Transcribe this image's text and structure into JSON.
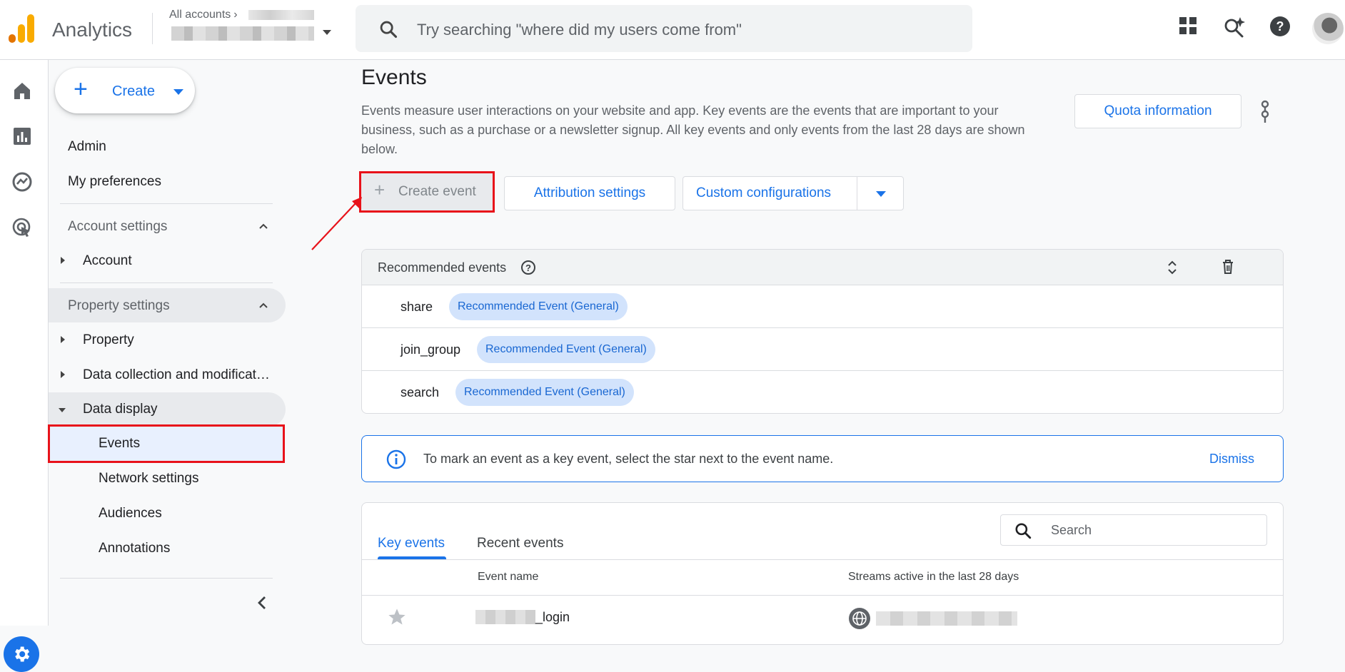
{
  "header": {
    "app_name": "Analytics",
    "accounts_label": "All accounts",
    "search_placeholder": "Try searching \"where did my users come from\""
  },
  "sidenav": {
    "create_label": "Create",
    "admin": "Admin",
    "my_preferences": "My preferences",
    "account_settings": "Account settings",
    "account": "Account",
    "property_settings": "Property settings",
    "property": "Property",
    "data_collection": "Data collection and modificat…",
    "data_display": "Data display",
    "events": "Events",
    "network_settings": "Network settings",
    "audiences": "Audiences",
    "annotations": "Annotations"
  },
  "page": {
    "title": "Events",
    "description": "Events measure user interactions on your website and app. Key events are the events that are important to your business, such as a purchase or a newsletter signup. All key events and only events from the last 28 days are shown below.",
    "quota_button": "Quota information",
    "create_event_button": "Create event",
    "attribution_button": "Attribution settings",
    "custom_config_button": "Custom configurations"
  },
  "recommended": {
    "title": "Recommended events",
    "rows": [
      {
        "name": "share",
        "chip": "Recommended Event (General)"
      },
      {
        "name": "join_group",
        "chip": "Recommended Event (General)"
      },
      {
        "name": "search",
        "chip": "Recommended Event (General)"
      }
    ]
  },
  "banner": {
    "text": "To mark an event as a key event, select the star next to the event name.",
    "dismiss": "Dismiss"
  },
  "events_table": {
    "tabs": [
      "Key events",
      "Recent events"
    ],
    "search_placeholder": "Search",
    "columns": [
      "Event name",
      "Streams active in the last 28 days"
    ],
    "first_row_name_suffix": "_login"
  },
  "colors": {
    "accent": "#1a73e8",
    "highlight_box": "#e8121a",
    "chip_bg": "#d2e3fc"
  }
}
